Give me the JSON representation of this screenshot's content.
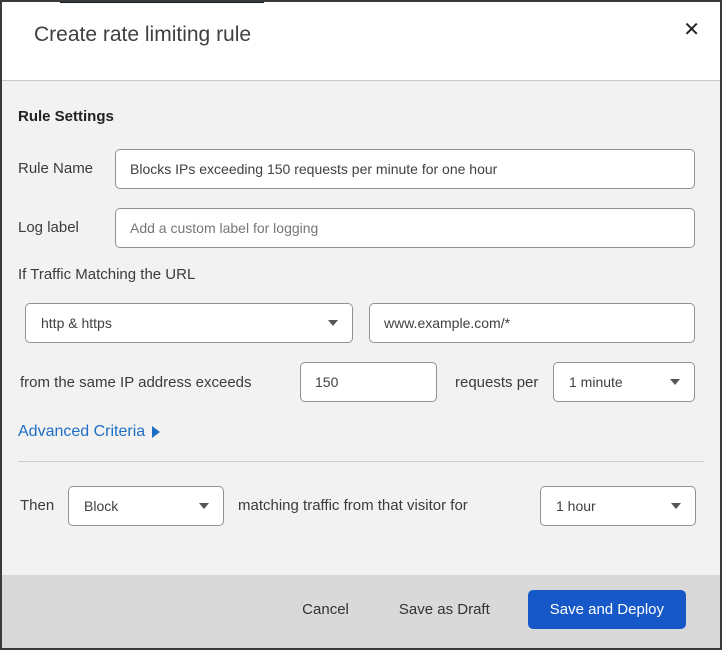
{
  "dialog": {
    "title": "Create rate limiting rule"
  },
  "icons": {
    "close": "✕"
  },
  "colors": {
    "primary_button": "#1658c8",
    "link_blue": "#1e6ec3",
    "top_strip": "#0d1e2d",
    "body_bg": "#f2f2f2",
    "footer_bg": "#d9d9d9"
  },
  "rule_settings": {
    "heading": "Rule Settings",
    "rule_name": {
      "label": "Rule Name",
      "value": "Blocks IPs exceeding 150 requests per minute for one hour"
    },
    "log_label": {
      "label": "Log label",
      "placeholder": "Add a custom label for logging"
    }
  },
  "criteria": {
    "intro": "If Traffic Matching the URL",
    "scheme_select": {
      "value": "http & https"
    },
    "url_input": {
      "value": "www.example.com/*"
    },
    "exceeds_text": "from the same IP address exceeds",
    "request_count": {
      "value": "150"
    },
    "requests_per_text": "requests per",
    "period_select": {
      "value": "1 minute"
    },
    "advanced_link": "Advanced Criteria"
  },
  "action": {
    "then_text": "Then",
    "action_select": {
      "value": "Block"
    },
    "matching_text": "matching traffic from that visitor for",
    "duration_select": {
      "value": "1 hour"
    }
  },
  "footer": {
    "cancel": "Cancel",
    "save_draft": "Save as Draft",
    "save_deploy": "Save and Deploy"
  }
}
